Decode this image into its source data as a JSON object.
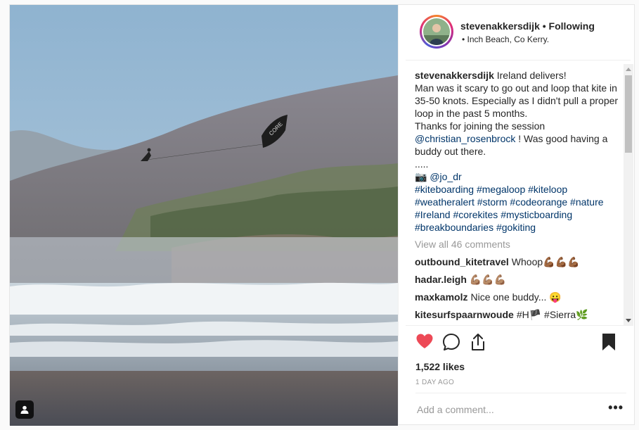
{
  "header": {
    "username": "stevenakkersdijk",
    "separator": "•",
    "follow_status": "Following",
    "location": "• Inch Beach, Co Kerry."
  },
  "caption": {
    "author": "stevenakkersdijk",
    "line1": "Ireland delivers!",
    "line2": "Man was it scary to go out and loop that kite in 35-50 knots. Especially as I didn't pull a proper loop in the past 5 months.",
    "line3": "Thanks for joining the session",
    "mention1": "@christian_rosenbrock",
    "line3b": " ! Was good having a buddy out there.",
    "dots": ".....",
    "camera": "📷",
    "mention2": "@jo_dr",
    "hashtags": [
      "#kiteboarding",
      "#megaloop",
      "#kiteloop",
      "#weatheralert",
      "#storm",
      "#codeorange",
      "#nature",
      "#Ireland",
      "#corekites",
      "#mysticboarding",
      "#breakboundaries",
      "#gokiting"
    ]
  },
  "view_all": "View all 46 comments",
  "comments": [
    {
      "user": "outbound_kitetravel",
      "text": "Whoop💪🏾💪🏾💪🏾"
    },
    {
      "user": "hadar.leigh",
      "text": "💪🏽💪🏽💪🏽"
    },
    {
      "user": "maxkamolz",
      "text": "Nice one buddy... 😛"
    },
    {
      "user": "kitesurfspaarnwoude",
      "text": "#H🏴 #Sierra🌿"
    }
  ],
  "likes": "1,522 likes",
  "time": "1 DAY AGO",
  "add_comment_placeholder": "Add a comment...",
  "more_label": "•••",
  "icons": {
    "like": "heart-icon",
    "comment": "comment-icon",
    "share": "share-icon",
    "save": "bookmark-icon",
    "tag": "user-tag-icon"
  },
  "colors": {
    "heart": "#ed4956",
    "link": "#003569",
    "muted": "#999999"
  }
}
